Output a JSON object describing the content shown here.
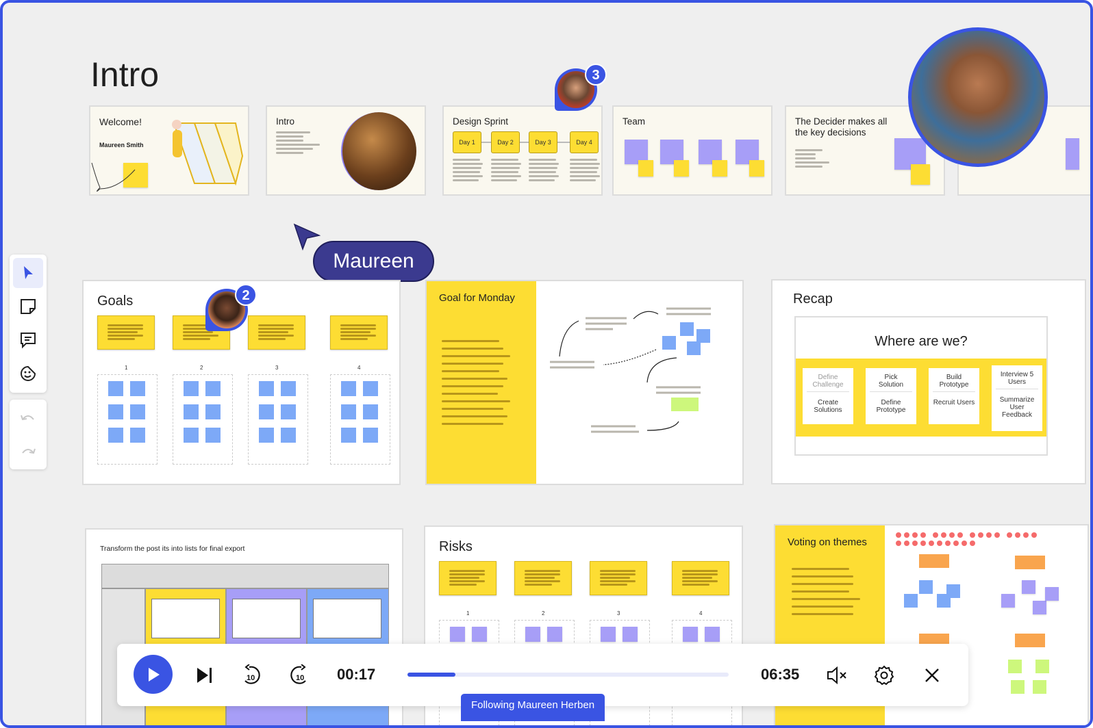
{
  "board": {
    "title": "Intro"
  },
  "thumbnails": [
    {
      "title": "Welcome!",
      "subtitle": "Maureen Smith"
    },
    {
      "title": "Intro"
    },
    {
      "title": "Design Sprint",
      "days": [
        "Day 1",
        "Day 2",
        "Day 3",
        "Day 4"
      ]
    },
    {
      "title": "Team"
    },
    {
      "title": "The Decider makes all the key decisions"
    }
  ],
  "collaborators": {
    "design_sprint_count": "3",
    "goals_count": "2",
    "cursor_name": "Maureen"
  },
  "frames": {
    "goals": {
      "title": "Goals",
      "columns": [
        "1",
        "2",
        "3",
        "4"
      ]
    },
    "goal_monday": {
      "title": "Goal for Monday"
    },
    "recap": {
      "title": "Recap",
      "heading": "Where are we?",
      "cards": [
        {
          "top": "Define Challenge",
          "bottom": "Create Solutions"
        },
        {
          "top": "Pick Solution",
          "bottom": "Define Prototype"
        },
        {
          "top": "Build Prototype",
          "bottom": "Recruit Users"
        },
        {
          "top": "Interview 5 Users",
          "bottom": "Summarize User Feedback"
        }
      ]
    },
    "export": {
      "title": "Transform the post its into lists for final export"
    },
    "risks": {
      "title": "Risks",
      "columns": [
        "1",
        "2",
        "3",
        "4"
      ]
    },
    "voting": {
      "title": "Voting on themes"
    }
  },
  "toolbar": {
    "tools": [
      "select",
      "sticky-note",
      "comment",
      "reaction"
    ],
    "active": "select"
  },
  "player": {
    "current_time": "00:17",
    "total_time": "06:35",
    "progress": 0.15,
    "following_label": "Following Maureen Herben"
  },
  "colors": {
    "accent": "#3a54e3",
    "yellow": "#fddd33",
    "purple": "#a79ef7",
    "blue": "#7da9f7",
    "background": "#efefef"
  }
}
